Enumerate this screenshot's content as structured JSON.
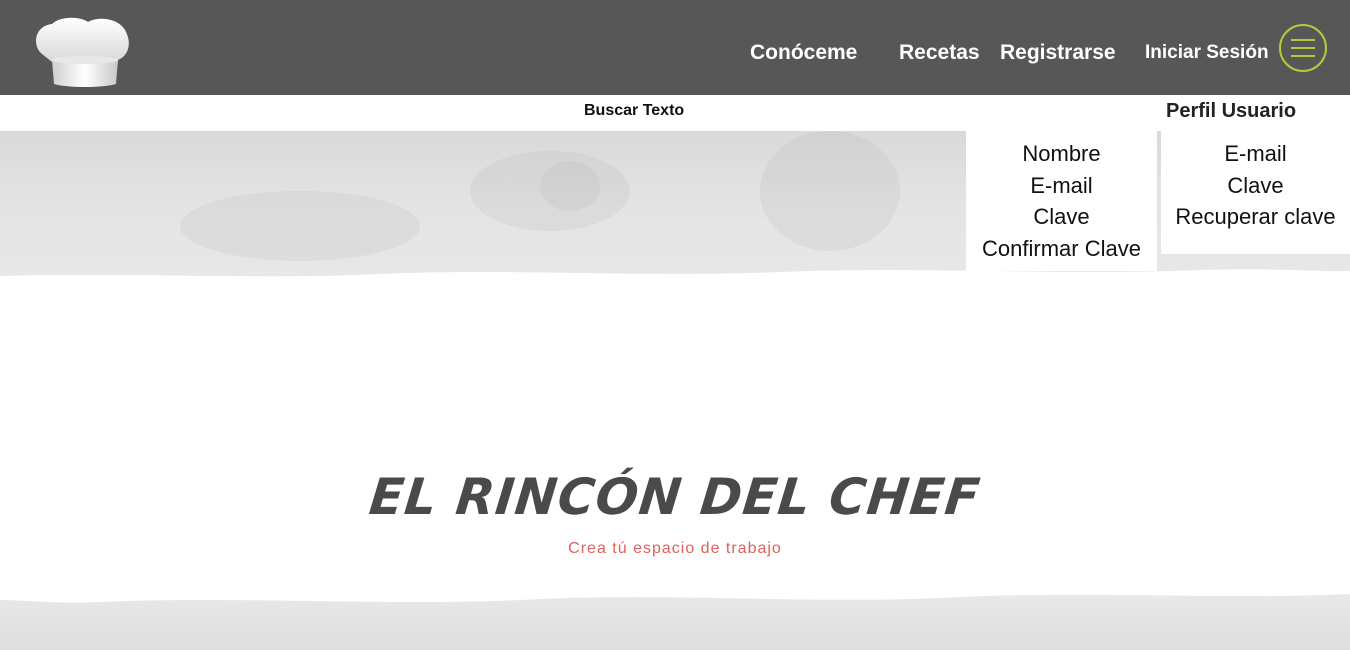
{
  "header": {
    "nav": {
      "conoceme": "Conóceme",
      "recetas": "Recetas",
      "registrarse": "Registrarse",
      "login": "Iniciar Sesión"
    },
    "logo_icon": "chef-hat-icon",
    "menu_icon": "hamburger-icon",
    "accent_color": "#b7c93a",
    "bar_color": "#575757"
  },
  "search": {
    "label": "Buscar Texto"
  },
  "register_form": {
    "fields": [
      "Nombre",
      "E-mail",
      "Clave",
      "Confirmar Clave"
    ]
  },
  "profile": {
    "title": "Perfil Usuario",
    "fields": [
      "E-mail",
      "Clave",
      "Recuperar clave"
    ]
  },
  "hero": {
    "title": "EL RINCÓN DEL CHEF",
    "subtitle": "Crea tú espacio de trabajo",
    "subtitle_color": "#e0605a"
  }
}
